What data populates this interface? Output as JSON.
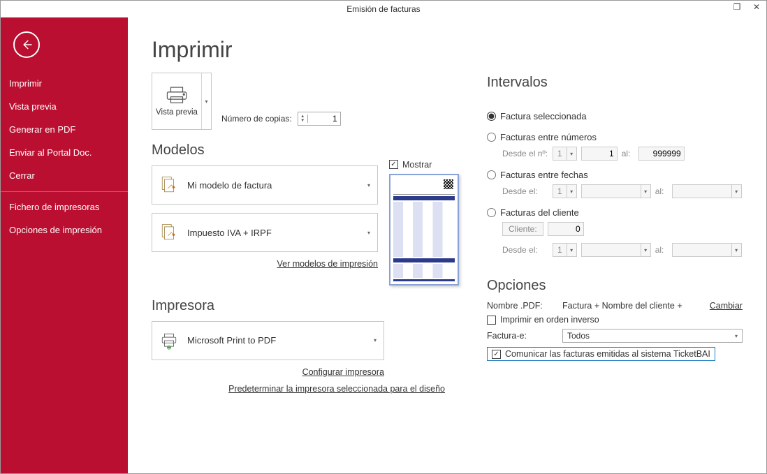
{
  "title": "Emisión de facturas",
  "sidebar": {
    "items": [
      {
        "label": "Imprimir"
      },
      {
        "label": "Vista previa"
      },
      {
        "label": "Generar en PDF"
      },
      {
        "label": "Enviar al Portal Doc."
      },
      {
        "label": "Cerrar"
      }
    ],
    "items2": [
      {
        "label": "Fichero de impresoras"
      },
      {
        "label": "Opciones de impresión"
      }
    ]
  },
  "main": {
    "heading": "Imprimir",
    "preview_btn": "Vista previa",
    "copies_label": "Número de copias:",
    "copies_value": "1",
    "models_heading": "Modelos",
    "model1": "Mi modelo de factura",
    "model2": "Impuesto IVA + IRPF",
    "models_link": "Ver modelos de impresión",
    "mostrar_label": "Mostrar",
    "printer_heading": "Impresora",
    "printer_name": "Microsoft Print to PDF",
    "printer_conf": "Configurar impresora",
    "printer_default": "Predeterminar la impresora seleccionada para el diseño"
  },
  "interv": {
    "heading": "Intervalos",
    "r1": "Factura seleccionada",
    "r2": "Facturas entre números",
    "r2_from_lbl": "Desde el nº:",
    "r2_from_serie": "1",
    "r2_from_num": "1",
    "r2_to_lbl": "al:",
    "r2_to_num": "999999",
    "r3": "Facturas entre fechas",
    "r3_from_lbl": "Desde el:",
    "r3_from_serie": "1",
    "r3_to_lbl": "al:",
    "r4": "Facturas del cliente",
    "r4_cli_lbl": "Cliente:",
    "r4_cli_val": "0",
    "r4_from_lbl": "Desde el:",
    "r4_from_serie": "1",
    "r4_to_lbl": "al:"
  },
  "opts": {
    "heading": "Opciones",
    "pdf_lbl": "Nombre .PDF:",
    "pdf_fmt": "Factura + Nombre del cliente +",
    "change": "Cambiar",
    "reverse": "Imprimir en orden inverso",
    "facte_lbl": "Factura-e:",
    "facte_val": "Todos",
    "tbai": "Comunicar las facturas emitidas al sistema TicketBAI"
  }
}
